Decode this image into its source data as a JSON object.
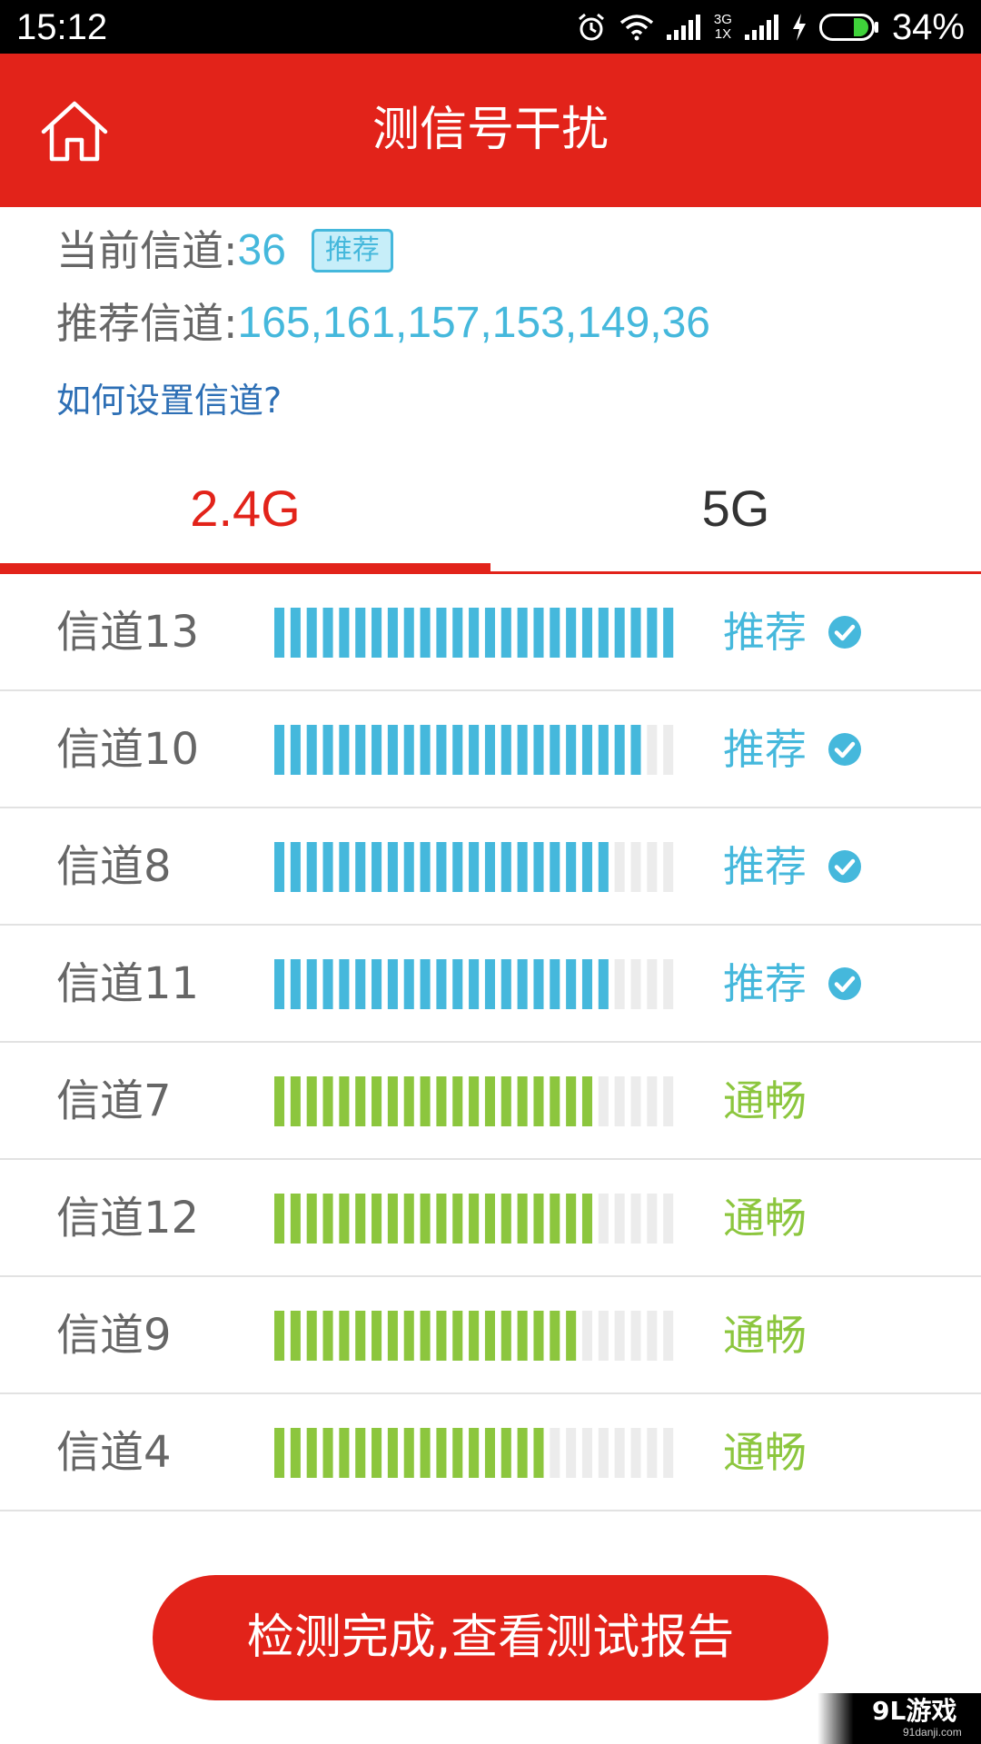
{
  "status_bar": {
    "time": "15:12",
    "network_type_top": "3G",
    "network_type_bottom": "1X",
    "battery_percent": "34%",
    "icons": [
      "alarm-icon",
      "wifi-icon",
      "signal-icon",
      "signal-icon",
      "charging-icon",
      "battery-icon"
    ]
  },
  "header": {
    "title": "测信号干扰",
    "home_icon": "home-icon"
  },
  "info": {
    "current_channel_label": "当前信道:",
    "current_channel_value": "36",
    "current_channel_badge": "推荐",
    "recommended_label": "推荐信道:",
    "recommended_value": "165,161,157,153,149,36",
    "help_link": "如何设置信道?"
  },
  "tabs": [
    {
      "label": "2.4G",
      "active": true
    },
    {
      "label": "5G",
      "active": false
    }
  ],
  "colors": {
    "brand_red": "#e2231a",
    "recommended_blue": "#45b8dc",
    "smooth_green": "#8cc63e",
    "empty_segment": "#ececec"
  },
  "bar_segments_total": 25,
  "channels": [
    {
      "name": "信道13",
      "level": 1.0,
      "status": "推荐",
      "recommended": true
    },
    {
      "name": "信道10",
      "level": 0.92,
      "status": "推荐",
      "recommended": true
    },
    {
      "name": "信道8",
      "level": 0.84,
      "status": "推荐",
      "recommended": true
    },
    {
      "name": "信道11",
      "level": 0.84,
      "status": "推荐",
      "recommended": true
    },
    {
      "name": "信道7",
      "level": 0.8,
      "status": "通畅",
      "recommended": false
    },
    {
      "name": "信道12",
      "level": 0.8,
      "status": "通畅",
      "recommended": false
    },
    {
      "name": "信道9",
      "level": 0.76,
      "status": "通畅",
      "recommended": false
    },
    {
      "name": "信道4",
      "level": 0.68,
      "status": "通畅",
      "recommended": false
    }
  ],
  "report_button": "检测完成,查看测试报告",
  "watermark": {
    "mark": "9L游戏",
    "url": "91danji.com"
  }
}
